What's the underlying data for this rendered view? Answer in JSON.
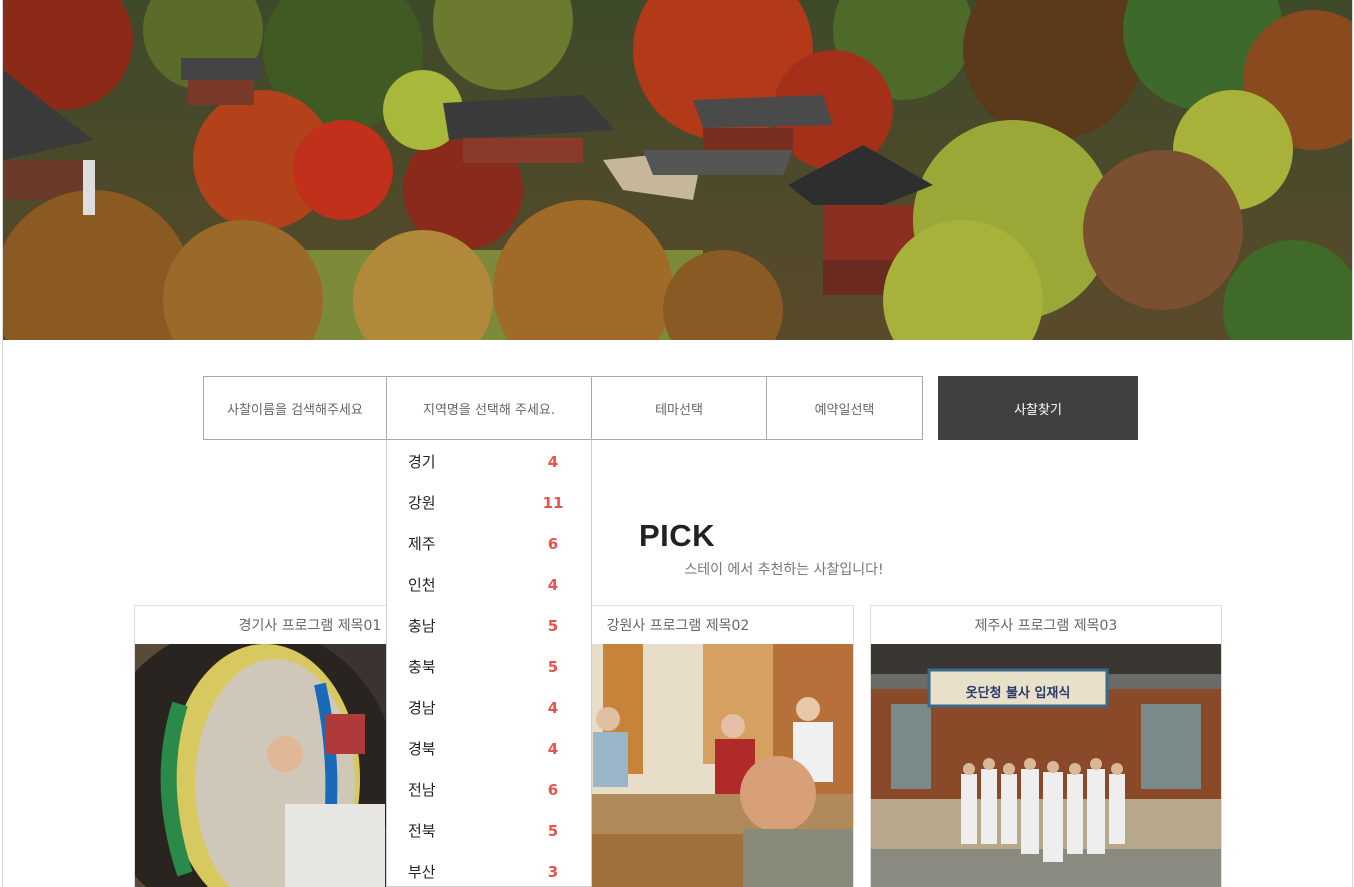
{
  "hero": {
    "image_icon": "temple-autumn-photo"
  },
  "search": {
    "name_placeholder": "사찰이름을 검색해주세요",
    "region_placeholder": "지역명을 선택해 주세요.",
    "theme_label": "테마선택",
    "date_label": "예약일선택",
    "find_button": "사찰찾기"
  },
  "regions": [
    {
      "name": "경기",
      "count": "4"
    },
    {
      "name": "강원",
      "count": "11"
    },
    {
      "name": "제주",
      "count": "6"
    },
    {
      "name": "인천",
      "count": "4"
    },
    {
      "name": "충남",
      "count": "5"
    },
    {
      "name": "충북",
      "count": "5"
    },
    {
      "name": "경남",
      "count": "4"
    },
    {
      "name": "경북",
      "count": "4"
    },
    {
      "name": "전남",
      "count": "6"
    },
    {
      "name": "전북",
      "count": "5"
    },
    {
      "name": "부산",
      "count": "3"
    }
  ],
  "pick": {
    "title": "PICK",
    "subtitle": "스테이 에서 추천하는 사찰입니다!"
  },
  "cards": [
    {
      "title": "경기사 프로그램 제목01",
      "image_icon": "drum-ceremony-photo"
    },
    {
      "title": "강원사 프로그램 제목02",
      "image_icon": "tea-ceremony-photo"
    },
    {
      "title": "제주사 프로그램 제목03",
      "image_icon": "group-photo"
    }
  ],
  "banner_text": "옷단청 불사 입재식",
  "colors": {
    "accent_count": "#e8534f",
    "button_bg": "#404040"
  }
}
